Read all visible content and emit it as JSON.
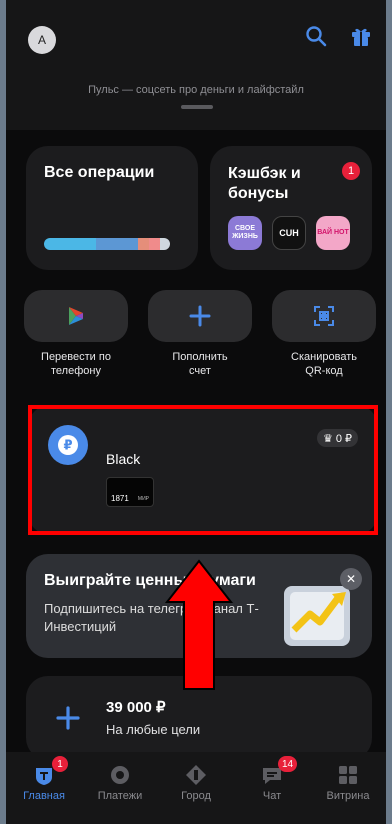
{
  "header": {
    "avatar_initial": "A",
    "puls_text": "Пульс — соцсеть про деньги и лайфстайл",
    "icons": [
      "search-icon",
      "gift-icon"
    ]
  },
  "operations": {
    "title": "Все операции",
    "bar_colors": [
      "#4bb7e6",
      "#5c97d4",
      "#e58e7a",
      "#f08b8b",
      "#cfd7df"
    ]
  },
  "cashback": {
    "title": "Кэшбэк и бонусы",
    "badge": "1",
    "partners": [
      {
        "label": "СВОЕ ЖИЗНЬ",
        "bg": "#8c7ad6",
        "color": "#ffffff"
      },
      {
        "label": "CUH",
        "bg": "#111111",
        "color": "#ffffff"
      },
      {
        "label": "ВАЙ НОТ",
        "bg": "#f3a7c8",
        "color": "#d2126a"
      }
    ]
  },
  "quick_actions": [
    {
      "label": "Перевести по телефону",
      "icon": "sbp-icon"
    },
    {
      "label": "Пополнить счет",
      "icon": "plus-icon"
    },
    {
      "label": "Сканировать QR-код",
      "icon": "qr-scan-icon"
    }
  ],
  "account": {
    "name": "Black",
    "balance": "0 ₽",
    "card_last_digits": "1871",
    "card_payment_system": "МИР"
  },
  "promo": {
    "title": "Выиграйте ценные бумаги",
    "text": "Подпишитесь на телеграм-канал Т-Инвестиций"
  },
  "savings_goal": {
    "amount": "39 000 ₽",
    "label": "На любые цели"
  },
  "bottom_nav": [
    {
      "label": "Главная",
      "badge": "1",
      "active": true
    },
    {
      "label": "Платежи",
      "badge": "",
      "active": false
    },
    {
      "label": "Город",
      "badge": "",
      "active": false
    },
    {
      "label": "Чат",
      "badge": "14",
      "active": false
    },
    {
      "label": "Витрина",
      "badge": "",
      "active": false
    }
  ],
  "colors": {
    "accent_blue": "#4a8ae8",
    "badge_red": "#e8203a",
    "highlight_red": "#ff0000"
  }
}
